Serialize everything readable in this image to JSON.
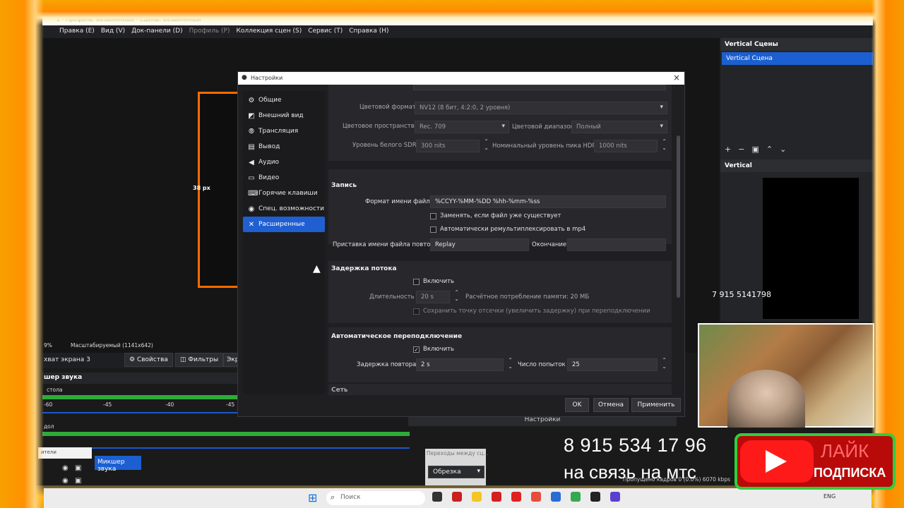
{
  "window": {
    "title": "1 - Профиль: Безымянный - Сцены: Безымянный",
    "menu": [
      "Правка (E)",
      "Вид (V)",
      "Док-панели (D)",
      "Профиль (P)",
      "Коллекция сцен (S)",
      "Сервис (T)",
      "Справка (H)"
    ]
  },
  "right_panel": {
    "scenes_title": "Vertical Сцены",
    "scene_item": "Vertical Сцена",
    "toolbar_icons": [
      "+",
      "−",
      "▣",
      "⌃",
      "⌄"
    ],
    "vertical_title": "Vertical"
  },
  "preview": {
    "size_label": "38 px"
  },
  "dialog": {
    "title": "Настройки",
    "close_icon": "close-icon",
    "nav": [
      {
        "label": "Общие",
        "icon": "gear-icon"
      },
      {
        "label": "Внешний вид",
        "icon": "palette-icon"
      },
      {
        "label": "Трансляция",
        "icon": "antenna-icon"
      },
      {
        "label": "Вывод",
        "icon": "output-icon"
      },
      {
        "label": "Аудио",
        "icon": "speaker-icon"
      },
      {
        "label": "Видео",
        "icon": "monitor-icon"
      },
      {
        "label": "Горячие клавиши",
        "icon": "keyboard-icon"
      },
      {
        "label": "Спец. возможности",
        "icon": "accessibility-icon"
      },
      {
        "label": "Расширенные",
        "icon": "wrench-icon"
      }
    ],
    "video": {
      "color_format_label": "Цветовой формат",
      "color_format_value": "NV12 (8 бит, 4:2:0, 2 уровня)",
      "color_space_label": "Цветовое пространство",
      "color_space_value": "Rec. 709",
      "color_range_label": "Цветовой диапазон",
      "color_range_value": "Полный",
      "sdr_white_label": "Уровень белого SDR",
      "sdr_white_value": "300 nits",
      "hdr_peak_label": "Номинальный уровень пика HDR",
      "hdr_peak_value": "1000 nits"
    },
    "recording": {
      "title": "Запись",
      "filename_format_label": "Формат имени файла",
      "filename_format_value": "%CCYY-%MM-%DD %hh-%mm-%ss",
      "overwrite_label": "Заменять, если файл уже существует",
      "remux_label": "Автоматически ремультиплексировать в mp4",
      "replay_prefix_label": "Приставка имени файла повтора",
      "replay_prefix_value": "Replay",
      "suffix_label": "Окончание",
      "suffix_value": ""
    },
    "stream_delay": {
      "title": "Задержка потока",
      "enable_label": "Включить",
      "duration_label": "Длительность",
      "duration_value": "20 s",
      "memory_note": "Расчётное потребление памяти: 20 МБ",
      "preserve_label": "Сохранить точку отсечки (увеличить задержку) при переподключении"
    },
    "reconnect": {
      "title": "Автоматическое переподключение",
      "enable_label": "Включить",
      "enable_checked": true,
      "retry_delay_label": "Задержка повтора",
      "retry_delay_value": "2 s",
      "max_retries_label": "Число попыток",
      "max_retries_value": "25"
    },
    "network": {
      "title": "Сеть"
    },
    "buttons": {
      "ok": "OK",
      "cancel": "Отмена",
      "apply": "Применить"
    }
  },
  "lower": {
    "zoom_label": "9%",
    "scale_label": "Масштабируемый (1141x642)",
    "source_name": "хват экрана 3",
    "properties_btn": "Свойства",
    "filters_btn": "Фильтры",
    "extra_btn": "Экр",
    "mixer_title": "шер звука",
    "mixer_track1": "столa",
    "mixer_track2": "дол",
    "meter_ticks": [
      "-60",
      "-45",
      "-40",
      "-45"
    ],
    "mixer_tab": "Микшер звука",
    "white_tab": "ители",
    "settings_bar": "Настройки",
    "transitions_head": "Переходы между сц...",
    "transition_value": "Обрезка"
  },
  "overlay": {
    "phone_small": "7 915 5141798",
    "phone_big": "8 915  534 17 96",
    "phone_sub": "на связь на мтс",
    "like_label": "ЛАЙК",
    "subscribe_label": "ПОДПИСКА"
  },
  "taskbar": {
    "search_placeholder": "Поиск",
    "tray": "ENG",
    "status_text": "Пропущено кадров 0 (0.0%)  6070 kbps"
  }
}
